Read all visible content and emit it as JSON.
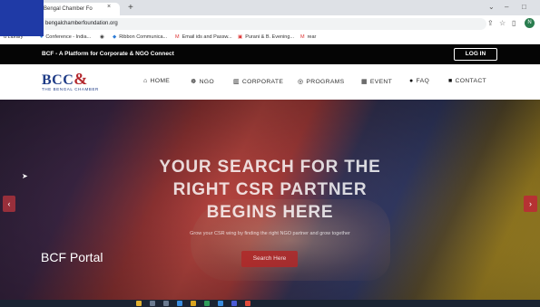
{
  "browser": {
    "tab_title": "Bengal Chamber Fo",
    "tab_close": "×",
    "new_tab": "+",
    "address": "bengalchamberfoundation.org",
    "window_controls": [
      "⌄",
      "–",
      "□"
    ],
    "profile_initial": "N",
    "bookmarks": [
      {
        "label": "d Library",
        "icon": "bookmark-icon"
      },
      {
        "label": "Conference - India...",
        "icon": "conference-icon"
      },
      {
        "label": "",
        "icon": "globe-icon"
      },
      {
        "label": "Ribbon Communica...",
        "icon": "ribbon-icon"
      },
      {
        "label": "Email ids and Passw...",
        "icon": "gmail-icon"
      },
      {
        "label": "Purani & B. Evening...",
        "icon": "calendar-icon"
      },
      {
        "label": "rear",
        "icon": "gmail-icon"
      }
    ]
  },
  "site": {
    "top_strip": "BCF - A Platform for Corporate & NGO Connect",
    "login": "LOG IN",
    "logo": {
      "main": "BCC",
      "amp": "&",
      "sub": "THE BENGAL CHAMBER"
    },
    "nav": [
      {
        "label": "HOME",
        "icon": "home-icon",
        "glyph": "⌂"
      },
      {
        "label": "NGO",
        "icon": "ngo-icon",
        "glyph": "☸"
      },
      {
        "label": "CORPORATE",
        "icon": "building-icon",
        "glyph": "▥"
      },
      {
        "label": "PROGRAMS",
        "icon": "programs-icon",
        "glyph": "◎"
      },
      {
        "label": "EVENT",
        "icon": "event-icon",
        "glyph": "▦"
      },
      {
        "label": "FAQ",
        "icon": "faq-icon",
        "glyph": "●"
      },
      {
        "label": "CONTACT",
        "icon": "contact-icon",
        "glyph": "■"
      }
    ],
    "hero": {
      "headline_lines": [
        "YOUR SEARCH FOR THE",
        "RIGHT CSR PARTNER",
        "BEGINS HERE"
      ],
      "subtitle": "Grow your CSR wing by finding the right NGO partner and grow together",
      "button": "Search Here",
      "prev": "‹",
      "next": "›"
    },
    "caption": "BCF Portal"
  },
  "colors": {
    "brand_blue": "#1e3b86",
    "brand_red": "#b3272d",
    "accent_button": "#b63233",
    "top_strip": "#050505"
  }
}
